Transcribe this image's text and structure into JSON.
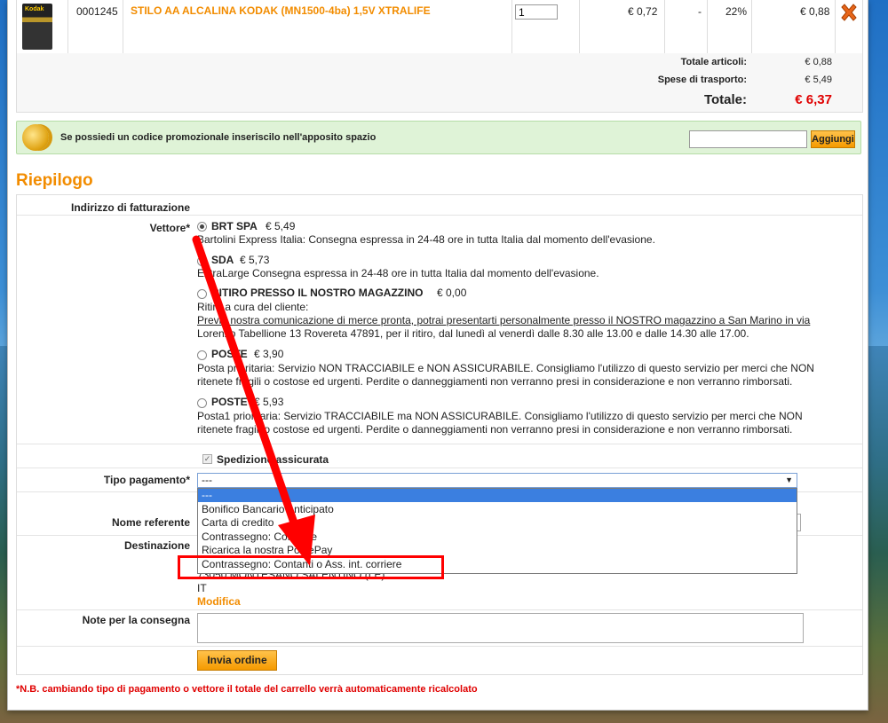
{
  "cart": {
    "item": {
      "thumb_brand": "Kodak",
      "code": "0001245",
      "name": "STILO AA ALCALINA KODAK (MN1500-4ba) 1,5V XTRALIFE",
      "qty": "1",
      "unit_price": "€ 0,72",
      "discount": "-",
      "vat": "22%",
      "total": "€ 0,88"
    },
    "totals": {
      "articles_label": "Totale articoli:",
      "articles_value": "€ 0,88",
      "shipping_label": "Spese di trasporto:",
      "shipping_value": "€ 5,49",
      "grand_label": "Totale:",
      "grand_value": "€ 6,37"
    }
  },
  "promo": {
    "text": "Se possiedi un codice promozionale inseriscilo nell'apposito spazio",
    "button": "Aggiungi"
  },
  "summary": {
    "title": "Riepilogo",
    "billing_label": "Indirizzo di fatturazione",
    "carrier_label": "Vettore*",
    "carriers": [
      {
        "name": "BRT SPA",
        "price": "€ 5,49",
        "desc1": "Bartolini Express Italia: Consegna espressa in 24-48 ore in tutta Italia dal momento dell'evasione.",
        "desc2": "",
        "desc3": "",
        "selected": true
      },
      {
        "name": "SDA",
        "price": "€ 5,73",
        "desc1": "ExtraLarge Consegna espressa in 24-48 ore in tutta Italia dal momento dell'evasione.",
        "desc2": "",
        "desc3": "",
        "selected": false
      },
      {
        "name": "RITIRO PRESSO IL NOSTRO MAGAZZINO",
        "price": "€ 0,00",
        "desc1": "Ritiro a cura del cliente:",
        "desc2": "Previa nostra comunicazione di merce pronta, potrai presentarti personalmente presso il NOSTRO magazzino a San Marino in via",
        "desc3": "Lorenzo Tabellione 13 Rovereta 47891, per il ritiro, dal lunedì al venerdì dalle 8.30 alle 13.00 e dalle 14.30 alle 17.00.",
        "selected": false
      },
      {
        "name": "POSTE",
        "price": "€ 3,90",
        "desc1": "Posta prioritaria: Servizio NON TRACCIABILE e NON ASSICURABILE. Consigliamo l'utilizzo di questo servizio per merci che NON",
        "desc2": "ritenete fragili o costose ed urgenti. Perdite o danneggiamenti non verranno presi in considerazione e non verranno rimborsati.",
        "desc3": "",
        "selected": false
      },
      {
        "name": "POSTE",
        "price": "€ 5,93",
        "desc1": "Posta1 prioritaria: Servizio TRACCIABILE ma NON ASSICURABILE. Consigliamo l'utilizzo di questo servizio per merci che NON",
        "desc2": "ritenete fragili o costose ed urgenti. Perdite o danneggiamenti non verranno presi in considerazione e non verranno rimborsati.",
        "desc3": "",
        "selected": false
      }
    ],
    "insured_label": "Spedizione assicurata",
    "payment_label": "Tipo pagamento*",
    "payment_value": "---",
    "payment_options": [
      "---",
      "Bonifico Bancario Anticipato",
      "Carta di credito",
      "Contrassegno: Contante",
      "Ricarica la nostra PostePay",
      "Contrassegno: Contanti o Ass. int. corriere"
    ],
    "referent_label": "Nome referente",
    "destination_label": "Destinazione",
    "destination_line": "73050 MONTESANO SALENTINO (LE)",
    "destination_country": "IT",
    "modify_link": "Modifica",
    "notes_label": "Note per la consegna",
    "submit_button": "Invia ordine",
    "footnote": "*N.B. cambiando tipo di pagamento o vettore il totale del carrello verrà automaticamente ricalcolato"
  },
  "colors": {
    "accent": "#f28c00",
    "danger": "#e00000",
    "promo_bg": "#dff3d7",
    "select_highlight": "#3b7fe0"
  }
}
